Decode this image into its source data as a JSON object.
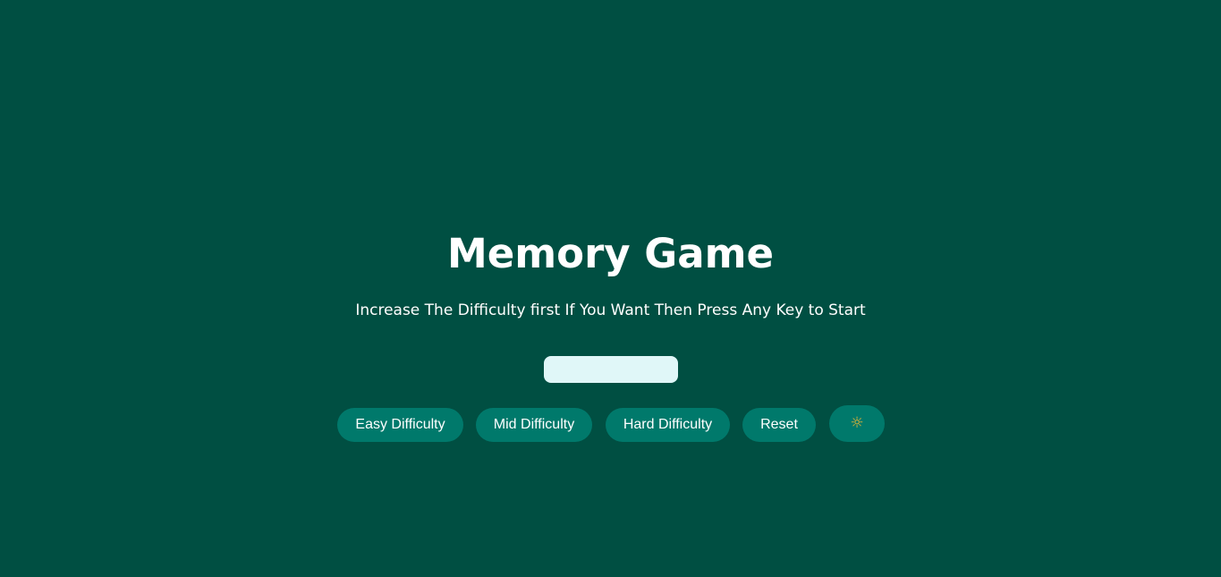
{
  "header": {
    "title": "Memory Game",
    "subtitle": "Increase The Difficulty first If You Want Then Press Any Key to Start"
  },
  "controls": {
    "easy_label": "Easy Difficulty",
    "mid_label": "Mid Difficulty",
    "hard_label": "Hard Difficulty",
    "reset_label": "Reset",
    "theme_toggle_icon": "☼"
  },
  "theme": {
    "background": "#004f42",
    "button": "#00796b",
    "level_bar": "#e0f7f8",
    "sun_icon": "#f2b632"
  }
}
